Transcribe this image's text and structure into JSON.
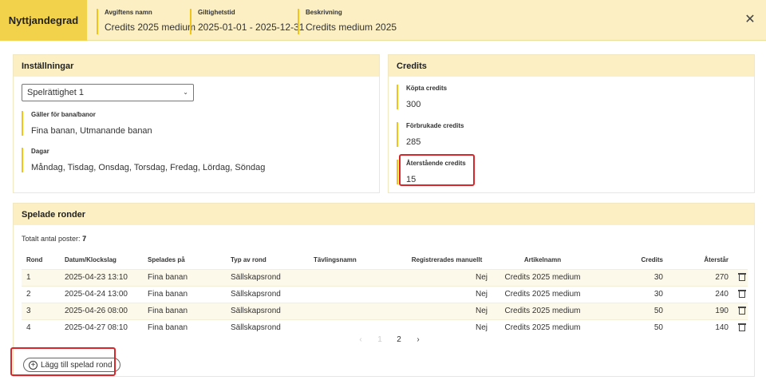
{
  "header": {
    "tab_label": "Nyttjandegrad",
    "fields": [
      {
        "label": "Avgiftens namn",
        "value": "Credits 2025 medium"
      },
      {
        "label": "Giltighetstid",
        "value": "2025-01-01 - 2025-12-31"
      },
      {
        "label": "Beskrivning",
        "value": "Credits medium 2025"
      }
    ],
    "close_symbol": "✕"
  },
  "settings": {
    "title": "Inställningar",
    "select_value": "Spelrättighet 1",
    "fields": [
      {
        "label": "Gäller för bana/banor",
        "value": "Fina banan, Utmanande banan"
      },
      {
        "label": "Dagar",
        "value": "Måndag, Tisdag, Onsdag, Torsdag, Fredag, Lördag, Söndag"
      }
    ]
  },
  "credits": {
    "title": "Credits",
    "fields": [
      {
        "label": "Köpta credits",
        "value": "300"
      },
      {
        "label": "Förbrukade credits",
        "value": "285"
      },
      {
        "label": "Återstående credits",
        "value": "15"
      }
    ]
  },
  "rounds": {
    "title": "Spelade ronder",
    "total_label": "Totalt antal poster:",
    "total_value": "7",
    "columns": [
      "Rond",
      "Datum/Klockslag",
      "Spelades på",
      "Typ av rond",
      "Tävlingsnamn",
      "Registrerades manuellt",
      "Artikelnamn",
      "Credits",
      "Återstår"
    ],
    "rows": [
      {
        "rond": "1",
        "datum": "2025-04-23 13:10",
        "bana": "Fina banan",
        "typ": "Sällskapsrond",
        "tavling": "",
        "manuellt": "Nej",
        "artikel": "Credits 2025 medium",
        "credits": "30",
        "aterstar": "270"
      },
      {
        "rond": "2",
        "datum": "2025-04-24 13:00",
        "bana": "Fina banan",
        "typ": "Sällskapsrond",
        "tavling": "",
        "manuellt": "Nej",
        "artikel": "Credits 2025 medium",
        "credits": "30",
        "aterstar": "240"
      },
      {
        "rond": "3",
        "datum": "2025-04-26 08:00",
        "bana": "Fina banan",
        "typ": "Sällskapsrond",
        "tavling": "",
        "manuellt": "Nej",
        "artikel": "Credits 2025 medium",
        "credits": "50",
        "aterstar": "190"
      },
      {
        "rond": "4",
        "datum": "2025-04-27 08:10",
        "bana": "Fina banan",
        "typ": "Sällskapsrond",
        "tavling": "",
        "manuellt": "Nej",
        "artikel": "Credits 2025 medium",
        "credits": "50",
        "aterstar": "140"
      }
    ],
    "pagination": {
      "prev": "‹",
      "first": "1",
      "current": "2",
      "next": "›"
    },
    "add_button_label": "Lägg till spelad rond"
  },
  "colors": {
    "accent": "#f2d24a",
    "header_bg": "#fbefc3",
    "highlight": "#d9262b"
  }
}
